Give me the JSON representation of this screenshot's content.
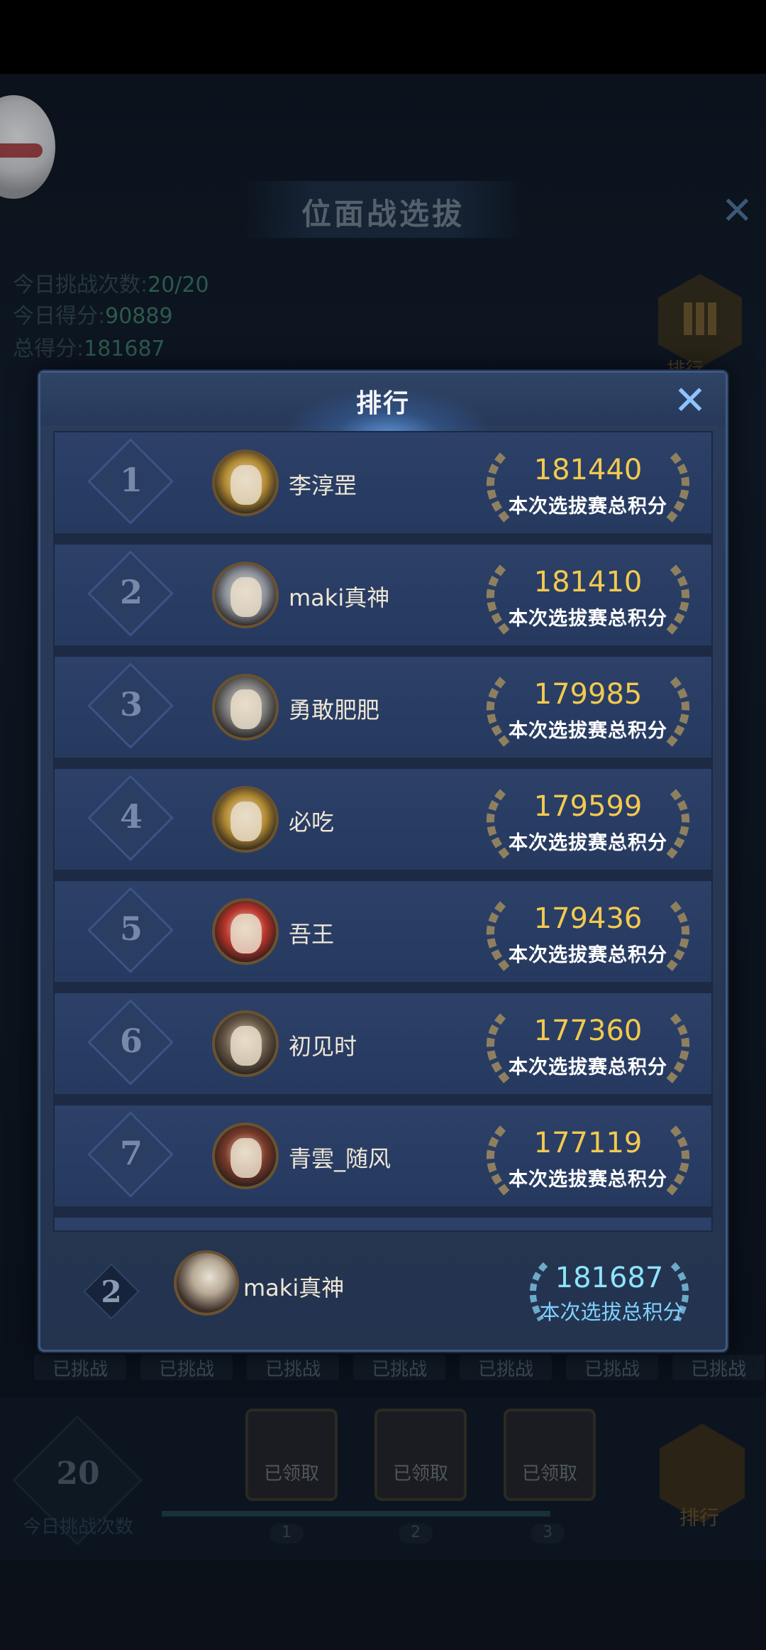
{
  "background": {
    "title": "位面战选拔",
    "stats": [
      {
        "label": "今日挑战次数:",
        "value": "20/20"
      },
      {
        "label": "今日得分:",
        "value": "90889"
      },
      {
        "label": "总得分:",
        "value": "181687"
      }
    ],
    "side_rank_label": "排行",
    "challenge_tags": [
      "已挑战",
      "已挑战",
      "已挑战",
      "已挑战",
      "已挑战",
      "已挑战",
      "已挑战"
    ],
    "today_count": "20",
    "today_count_label": "今日挑战次数",
    "chests": [
      {
        "label": "已领取",
        "step": "1"
      },
      {
        "label": "已领取",
        "step": "2"
      },
      {
        "label": "已领取",
        "step": "3"
      }
    ],
    "trophy_label": "排行",
    "close_icon": "close-icon"
  },
  "modal": {
    "title": "排行",
    "close_icon": "close-icon",
    "rows": [
      {
        "rank": "1",
        "name": "李淳罡",
        "score": "181440",
        "score_label": "本次选拔赛总积分",
        "avatar_color": "#b28a32"
      },
      {
        "rank": "2",
        "name": "maki真神",
        "score": "181410",
        "score_label": "本次选拔赛总积分",
        "avatar_color": "#8a8f98"
      },
      {
        "rank": "3",
        "name": "勇敢肥肥",
        "score": "179985",
        "score_label": "本次选拔赛总积分",
        "avatar_color": "#7a7a7a"
      },
      {
        "rank": "4",
        "name": "必吃",
        "score": "179599",
        "score_label": "本次选拔赛总积分",
        "avatar_color": "#b28a32"
      },
      {
        "rank": "5",
        "name": "吾王",
        "score": "179436",
        "score_label": "本次选拔赛总积分",
        "avatar_color": "#b8342a"
      },
      {
        "rank": "6",
        "name": "初见时",
        "score": "177360",
        "score_label": "本次选拔赛总积分",
        "avatar_color": "#6a5a48"
      },
      {
        "rank": "7",
        "name": "青雲_随风",
        "score": "177119",
        "score_label": "本次选拔赛总积分",
        "avatar_color": "#7a3a2a"
      }
    ],
    "own": {
      "rank": "2",
      "name": "maki真神",
      "score": "181687",
      "score_label": "本次选拔总积分"
    },
    "colors": {
      "score_gold": "#f3c94e",
      "own_score_cyan": "#8ee3ff",
      "close_blue": "#8fc3ff"
    }
  }
}
